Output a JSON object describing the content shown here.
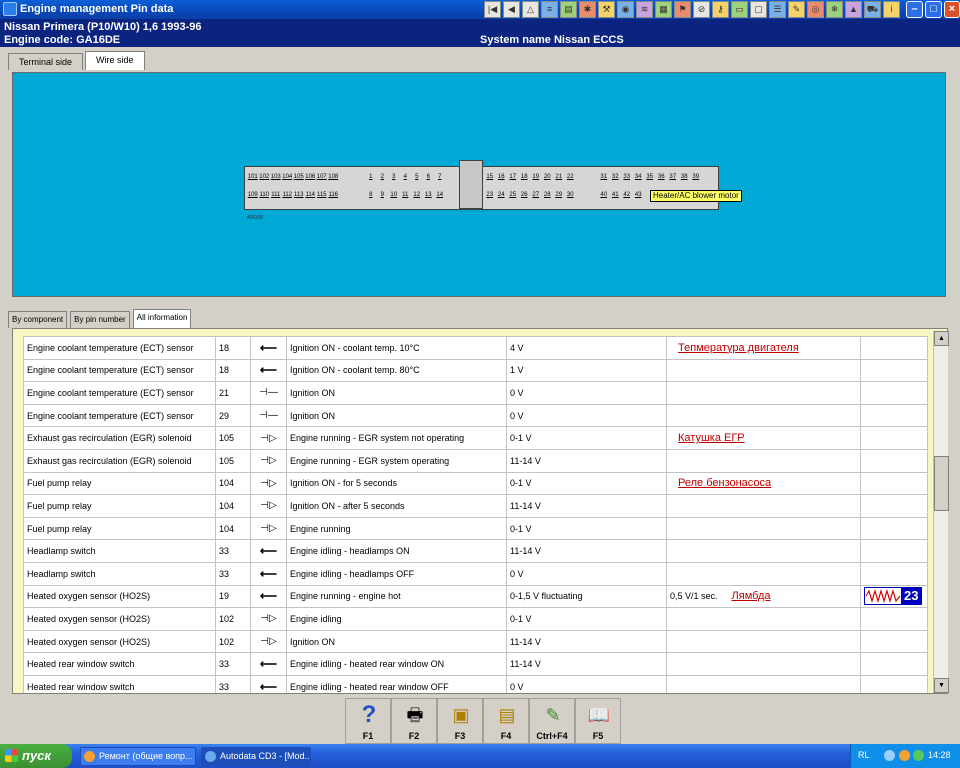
{
  "window": {
    "title": "Engine management Pin data"
  },
  "info": {
    "vehicle": "Nissan   Primera (P10/W10) 1,6   1993-96",
    "engine_code": "Engine code: GA16DE",
    "system_name": "System name Nissan ECCS"
  },
  "top_tabs": [
    "Terminal side",
    "Wire side"
  ],
  "connector": {
    "row1_left": [
      "101",
      "102",
      "103",
      "104",
      "105",
      "106",
      "107",
      "108"
    ],
    "row1_mid": [
      "1",
      "2",
      "3",
      "4",
      "5",
      "6",
      "7"
    ],
    "row1_right1": [
      "15",
      "16",
      "17",
      "18",
      "19",
      "20",
      "21",
      "22"
    ],
    "row1_right2": [
      "31",
      "32",
      "33",
      "34",
      "35",
      "36",
      "37",
      "38",
      "39"
    ],
    "row2_left": [
      "109",
      "110",
      "111",
      "112",
      "113",
      "114",
      "115",
      "116"
    ],
    "row2_mid": [
      "8",
      "9",
      "10",
      "11",
      "12",
      "13",
      "14"
    ],
    "row2_right1": [
      "23",
      "24",
      "25",
      "26",
      "27",
      "28",
      "29",
      "30"
    ],
    "row2_right2": [
      "40",
      "41",
      "42",
      "43"
    ],
    "small_label": "A06/08",
    "tooltip": "Heater/AC blower motor"
  },
  "lower_tabs": [
    "By component",
    "By pin number",
    "All information"
  ],
  "rows": [
    {
      "component": "Engine coolant temperature (ECT) sensor",
      "pin": "18",
      "sym": "in",
      "condition": "Ignition ON - coolant temp. 10°C",
      "value": "4 V",
      "extra": "",
      "note": "Тепмература двигателя",
      "scope": ""
    },
    {
      "component": "Engine coolant temperature (ECT) sensor",
      "pin": "18",
      "sym": "in",
      "condition": "Ignition ON - coolant temp. 80°C",
      "value": "1 V",
      "extra": "",
      "note": "",
      "scope": ""
    },
    {
      "component": "Engine coolant temperature (ECT) sensor",
      "pin": "21",
      "sym": "gnd",
      "condition": "Ignition ON",
      "value": "0 V",
      "extra": "",
      "note": "",
      "scope": ""
    },
    {
      "component": "Engine coolant temperature (ECT) sensor",
      "pin": "29",
      "sym": "gnd",
      "condition": "Ignition ON",
      "value": "0 V",
      "extra": "",
      "note": "",
      "scope": ""
    },
    {
      "component": "Exhaust gas recirculation (EGR) solenoid",
      "pin": "105",
      "sym": "out",
      "condition": "Engine running - EGR system not operating",
      "value": "0-1 V",
      "extra": "",
      "note": "Катушка ЕГР",
      "scope": ""
    },
    {
      "component": "Exhaust gas recirculation (EGR) solenoid",
      "pin": "105",
      "sym": "out",
      "condition": "Engine running - EGR system operating",
      "value": "11-14 V",
      "extra": "",
      "note": "",
      "scope": ""
    },
    {
      "component": "Fuel pump relay",
      "pin": "104",
      "sym": "out",
      "condition": "Ignition ON - for 5 seconds",
      "value": "0-1 V",
      "extra": "",
      "note": "Реле бензонасоса",
      "scope": ""
    },
    {
      "component": "Fuel pump relay",
      "pin": "104",
      "sym": "out",
      "condition": "Ignition ON - after 5 seconds",
      "value": "11-14 V",
      "extra": "",
      "note": "",
      "scope": ""
    },
    {
      "component": "Fuel pump relay",
      "pin": "104",
      "sym": "out",
      "condition": "Engine running",
      "value": "0-1 V",
      "extra": "",
      "note": "",
      "scope": ""
    },
    {
      "component": "Headlamp switch",
      "pin": "33",
      "sym": "in",
      "condition": "Engine idling - headlamps ON",
      "value": "11-14 V",
      "extra": "",
      "note": "",
      "scope": ""
    },
    {
      "component": "Headlamp switch",
      "pin": "33",
      "sym": "in",
      "condition": "Engine idling - headlamps OFF",
      "value": "0 V",
      "extra": "",
      "note": "",
      "scope": ""
    },
    {
      "component": "Heated oxygen sensor (HO2S)",
      "pin": "19",
      "sym": "in",
      "condition": "Engine running - engine hot",
      "value": "0-1,5 V fluctuating",
      "extra": "0,5 V/1 sec.",
      "note": "Лямбда",
      "scope": "23"
    },
    {
      "component": "Heated oxygen sensor (HO2S)",
      "pin": "102",
      "sym": "out",
      "condition": "Engine idling",
      "value": "0-1 V",
      "extra": "",
      "note": "",
      "scope": ""
    },
    {
      "component": "Heated oxygen sensor (HO2S)",
      "pin": "102",
      "sym": "out",
      "condition": "Ignition ON",
      "value": "11-14 V",
      "extra": "",
      "note": "",
      "scope": ""
    },
    {
      "component": "Heated rear window switch",
      "pin": "33",
      "sym": "in",
      "condition": "Engine idling - heated rear window ON",
      "value": "11-14 V",
      "extra": "",
      "note": "",
      "scope": ""
    },
    {
      "component": "Heated rear window switch",
      "pin": "33",
      "sym": "in",
      "condition": "Engine idling - heated rear window OFF",
      "value": "0 V",
      "extra": "",
      "note": "",
      "scope": ""
    }
  ],
  "fkeys": [
    {
      "label": "F1",
      "icon": "help-icon"
    },
    {
      "label": "F2",
      "icon": "print-icon"
    },
    {
      "label": "F3",
      "icon": "print-preview-icon"
    },
    {
      "label": "F4",
      "icon": "print-setup-icon"
    },
    {
      "label": "Ctrl+F4",
      "icon": "notes-icon"
    },
    {
      "label": "F5",
      "icon": "book-icon"
    }
  ],
  "taskbar": {
    "start": "пуск",
    "tasks": [
      "Ремонт (общие вопр...",
      "Autodata CD3 - [Mod..."
    ],
    "lang": "RL",
    "clock": "14:28"
  }
}
